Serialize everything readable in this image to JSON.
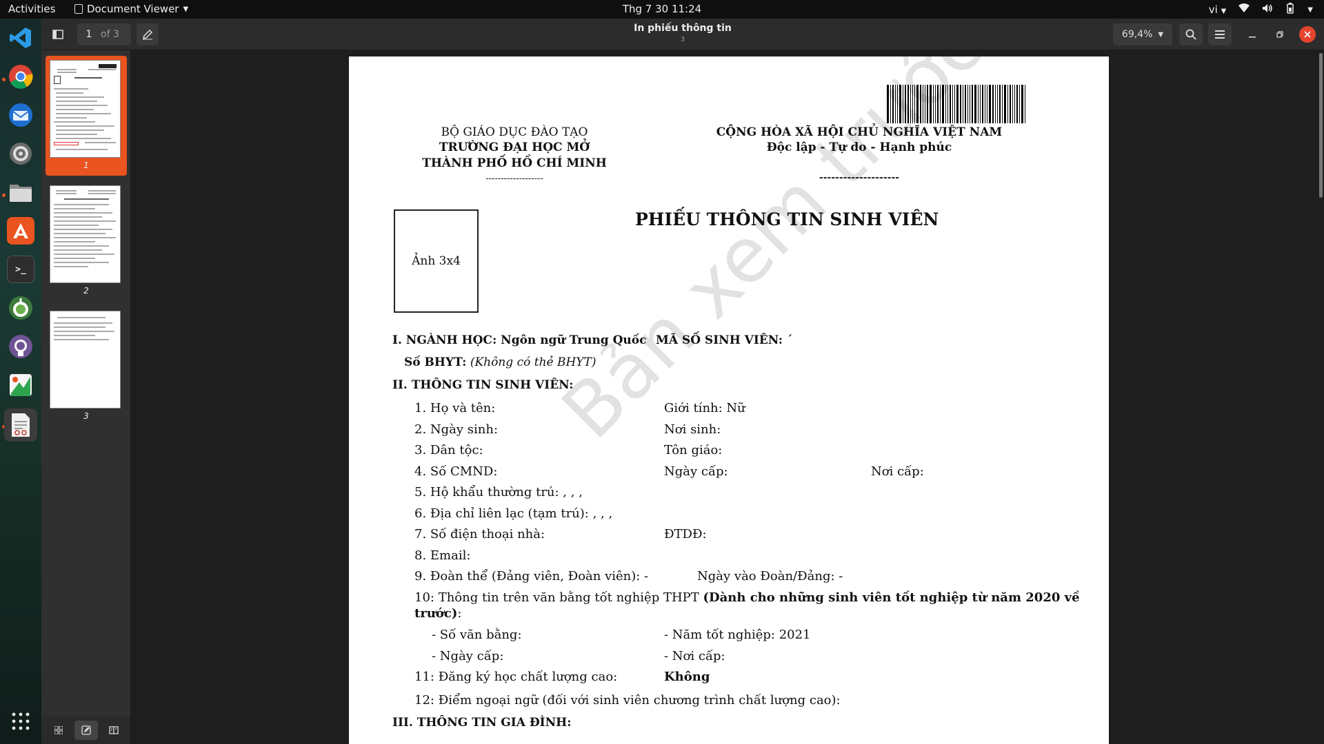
{
  "topbar": {
    "activities": "Activities",
    "app_name": "Document Viewer",
    "clock": "Thg 7 30  11:24",
    "language": "vi"
  },
  "dock": {
    "icons": [
      "vscode-icon",
      "chrome-icon",
      "thunderbird-icon",
      "settings-icon",
      "files-icon",
      "app-center-icon",
      "terminal-icon",
      "tor-icon",
      "github-icon",
      "drawing-icon",
      "document-viewer-icon",
      "show-apps-icon"
    ]
  },
  "headerbar": {
    "page_current": "1",
    "page_total_label": "of 3",
    "title": "In phiếu thông tin",
    "subtitle": "3",
    "zoom": "69,4%"
  },
  "sidebar": {
    "pages": [
      "1",
      "2",
      "3"
    ],
    "selected_page": "1"
  },
  "document": {
    "left_header_1": "BỘ GIÁO DỤC ĐÀO TẠO",
    "left_header_2": "TRƯỜNG ĐẠI HỌC MỞ",
    "left_header_3": "THÀNH PHỐ HỒ CHÍ MINH",
    "left_header_dashes": "-------------------",
    "right_header_1": "CỘNG HÒA XÃ HỘI CHỦ NGHĨA VIỆT NAM",
    "right_header_2": "Độc lập - Tự do - Hạnh phúc",
    "right_header_dashes": "--------------------",
    "photo_label": "Ảnh 3x4",
    "form_title": "PHIẾU THÔNG TIN SINH VIÊN",
    "major_label": "I. NGÀNH HỌC: Ngôn ngữ Trung Quốc",
    "student_id_label": "MÃ SỐ SINH VIÊN: ´",
    "insurance_label": "Số BHYT:",
    "insurance_value": "(Không có thẻ BHYT)",
    "section2": "II. THÔNG TIN SINH VIÊN:",
    "f1": "1. Họ và tên:",
    "f1_gender": "Giới tính: Nữ",
    "f2": "2. Ngày sinh:",
    "f2_place": "Nơi sinh:",
    "f3": "3. Dân tộc:",
    "f3_religion": "Tôn giáo:",
    "f4": "4. Số CMND:",
    "f4_issue_date": "Ngày cấp:",
    "f4_issue_place": "Nơi cấp:",
    "f5": "5. Hộ khẩu thường trú: , , ,",
    "f6": "6. Địa chỉ liên lạc (tạm trú): , , ,",
    "f7": "7. Số điện thoại nhà:",
    "f7_mobile": "ĐTDĐ:",
    "f8": "8. Email:",
    "f9": "9. Đoàn thể (Đảng viên, Đoàn viên): -",
    "f9_date": "Ngày vào Đoàn/Đảng: -",
    "f10_plain": "10: Thông tin trên văn bằng tốt nghiệp THPT ",
    "f10_bold": "(Dành cho những sinh viên tốt nghiệp từ năm 2020 về",
    "f10_bold_2": "trước)",
    "f10_colon": ":",
    "f10_cert": "- Số văn bằng:",
    "f10_year": "- Năm tốt nghiệp: 2021",
    "f10_date": "- Ngày cấp:",
    "f10_place": "- Nơi cấp:",
    "f11": "11: Đăng ký học chất lượng cao:",
    "f11_value": "Không",
    "f12": "12: Điểm ngoại ngữ (đối với sinh viên chương trình chất lượng cao):",
    "section3": "III. THÔNG TIN GIA ĐÌNH:",
    "watermark": "Bản xem trước"
  }
}
